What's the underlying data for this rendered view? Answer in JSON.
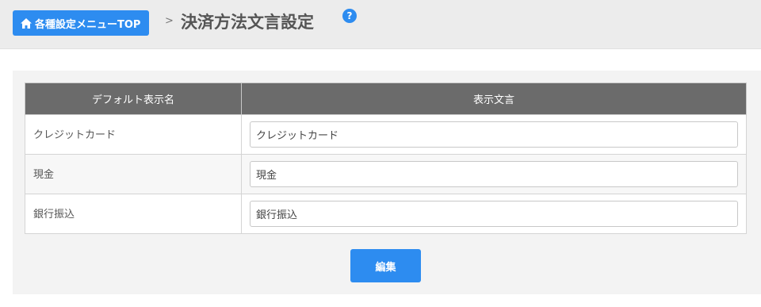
{
  "header": {
    "home_button_label": "各種設定メニューTOP",
    "breadcrumb_separator": ">",
    "page_title": "決済方法文言設定",
    "help_icon_glyph": "?"
  },
  "table": {
    "columns": [
      "デフォルト表示名",
      "表示文言"
    ],
    "rows": [
      {
        "default_name": "クレジットカード",
        "display_text": "クレジットカード"
      },
      {
        "default_name": "現金",
        "display_text": "現金"
      },
      {
        "default_name": "銀行振込",
        "display_text": "銀行振込"
      }
    ]
  },
  "actions": {
    "edit_label": "編集"
  },
  "colors": {
    "accent": "#2d8cf0",
    "table_header": "#6b6b6b"
  }
}
